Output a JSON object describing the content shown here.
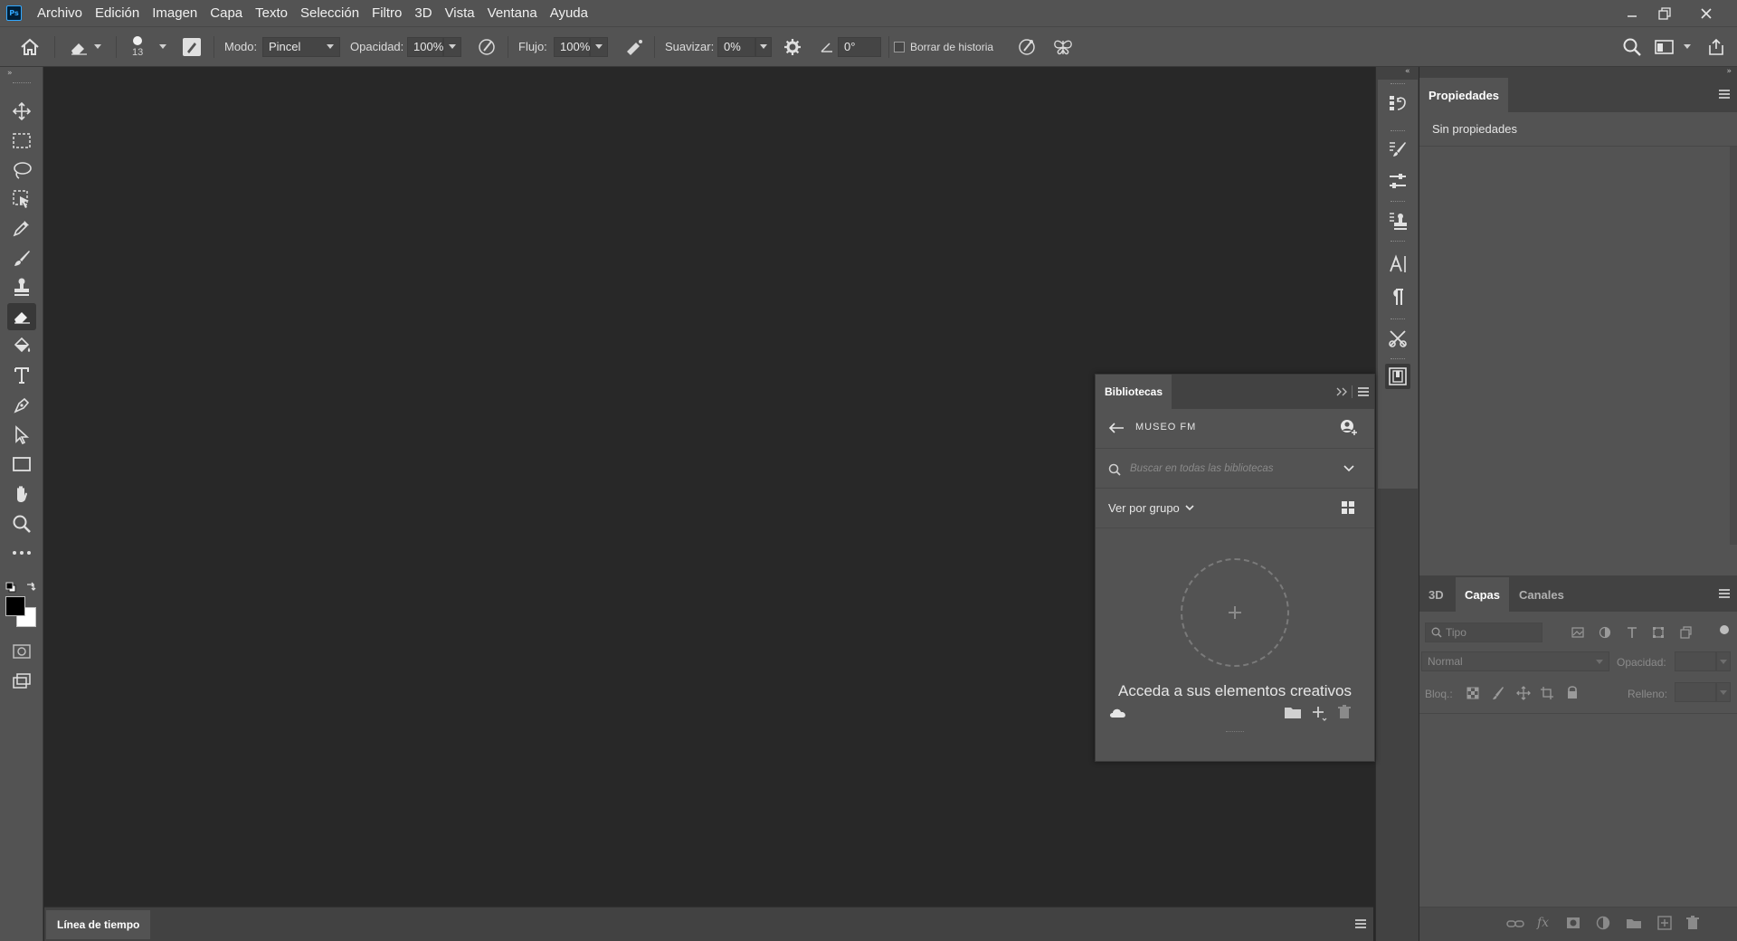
{
  "app": {
    "logo_text": "Ps"
  },
  "menu": [
    "Archivo",
    "Edición",
    "Imagen",
    "Capa",
    "Texto",
    "Selección",
    "Filtro",
    "3D",
    "Vista",
    "Ventana",
    "Ayuda"
  ],
  "options_bar": {
    "brush_size": "13",
    "mode_label": "Modo:",
    "mode_value": "Pincel",
    "opacity_label": "Opacidad:",
    "opacity_value": "100%",
    "flow_label": "Flujo:",
    "flow_value": "100%",
    "smoothing_label": "Suavizar:",
    "smoothing_value": "0%",
    "angle_value": "0°",
    "erase_history_label": "Borrar de historia",
    "erase_history_checked": false
  },
  "timeline": {
    "tab_label": "Línea de tiempo"
  },
  "properties": {
    "tab_label": "Propiedades",
    "empty_text": "Sin propiedades"
  },
  "layers": {
    "tabs": [
      "3D",
      "Capas",
      "Canales"
    ],
    "active_tab": "Capas",
    "filter_placeholder": "Tipo",
    "blend_mode": "Normal",
    "opacity_label": "Opacidad:",
    "lock_label": "Bloq.:",
    "fill_label": "Relleno:"
  },
  "libraries": {
    "tab_label": "Bibliotecas",
    "library_name": "MUSEO FM",
    "search_placeholder": "Buscar en todas las bibliotecas",
    "view_label": "Ver por grupo",
    "promo_text": "Acceda a sus elementos creativos"
  },
  "colors": {
    "foreground": "#000000",
    "background": "#ffffff",
    "ps_logo_blue": "#31a8ff",
    "ps_logo_bg": "#001e36"
  }
}
